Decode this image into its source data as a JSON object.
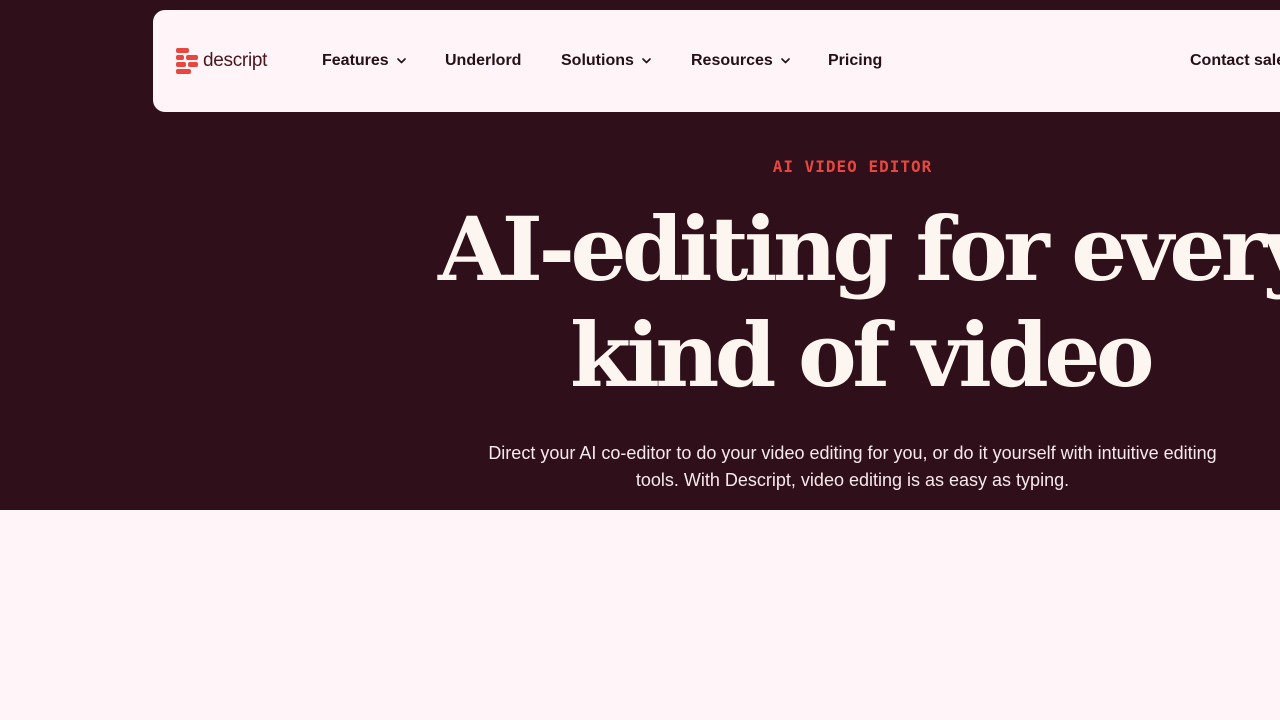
{
  "brand": {
    "name": "descript",
    "accent_color": "#e8473f",
    "hero_background": "#2f0f19",
    "nav_background": "#fff4f7"
  },
  "nav": {
    "items": [
      {
        "label": "Features",
        "has_dropdown": true,
        "icon": "chevron-down-icon"
      },
      {
        "label": "Underlord",
        "has_dropdown": false
      },
      {
        "label": "Solutions",
        "has_dropdown": true,
        "icon": "chevron-down-icon"
      },
      {
        "label": "Resources",
        "has_dropdown": true,
        "icon": "chevron-down-icon"
      },
      {
        "label": "Pricing",
        "has_dropdown": false
      }
    ],
    "contact_label": "Contact sale"
  },
  "hero": {
    "eyebrow": "AI VIDEO EDITOR",
    "headline_line1": "AI-editing for every",
    "headline_line2": "kind of video",
    "subtext": "Direct your AI co-editor to do your video editing for you, or do it yourself with intuitive editing tools. With Descript, video editing is as easy as typing."
  }
}
